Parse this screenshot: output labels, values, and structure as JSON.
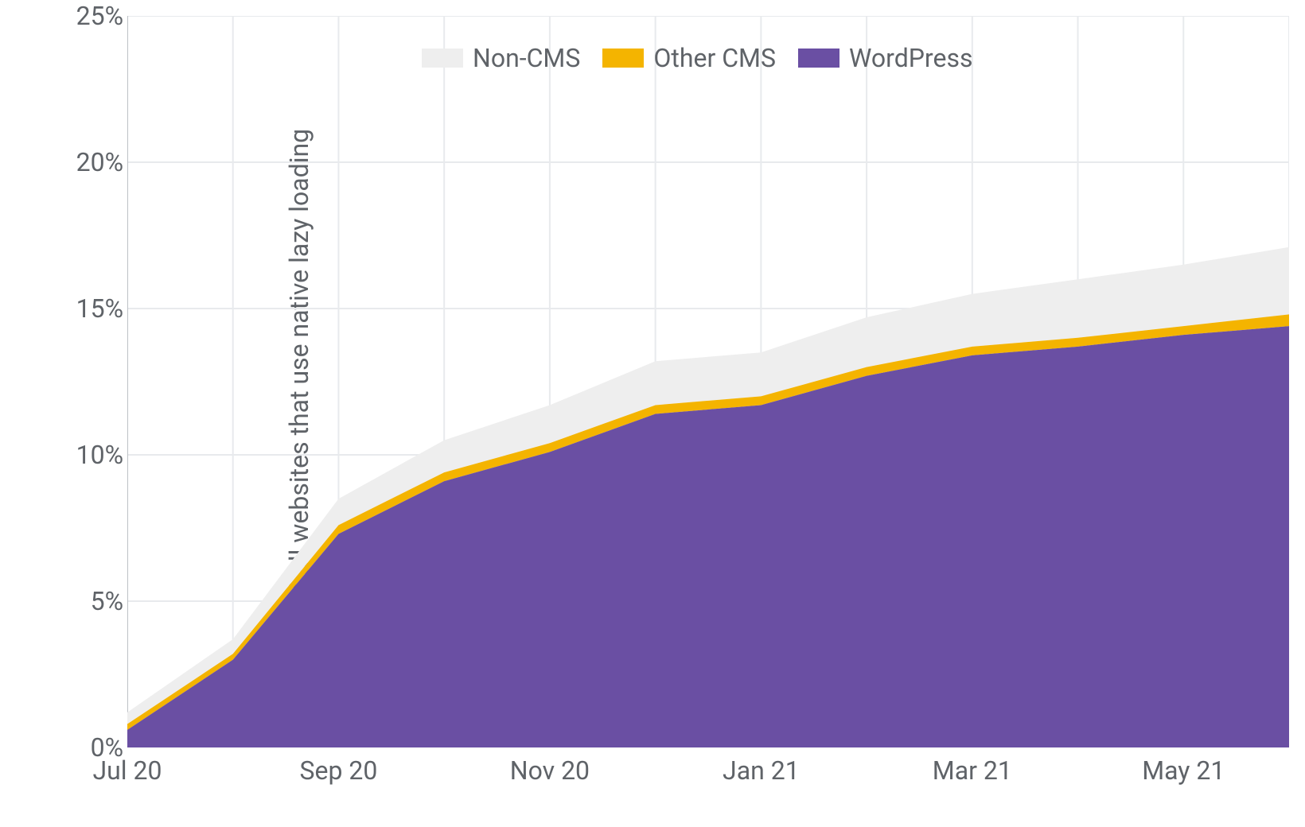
{
  "chart_data": {
    "type": "area",
    "ylabel": "Percent of all websites that use native lazy loading",
    "xlabel": "",
    "ylim": [
      0,
      25
    ],
    "y_ticks": [
      0,
      5,
      10,
      15,
      20,
      25
    ],
    "y_tick_labels": [
      "0%",
      "5%",
      "10%",
      "15%",
      "20%",
      "25%"
    ],
    "categories_full": [
      "Jul 20",
      "Aug 20",
      "Sep 20",
      "Oct 20",
      "Nov 20",
      "Dec 20",
      "Jan 21",
      "Feb 21",
      "Mar 21",
      "Apr 21",
      "May 21",
      "Jun 21"
    ],
    "x_tick_labels": [
      "Jul 20",
      "Sep 20",
      "Nov 20",
      "Jan 21",
      "Mar 21",
      "May 21"
    ],
    "x_tick_indices": [
      0,
      2,
      4,
      6,
      8,
      10
    ],
    "series": [
      {
        "name": "WordPress",
        "color": "#6a4fa3",
        "values": [
          0.6,
          3.0,
          7.3,
          9.1,
          10.1,
          11.4,
          11.7,
          12.7,
          13.4,
          13.7,
          14.1,
          14.4
        ]
      },
      {
        "name": "Other CMS",
        "color": "#f4b400",
        "values": [
          0.2,
          0.2,
          0.3,
          0.3,
          0.3,
          0.3,
          0.3,
          0.3,
          0.3,
          0.3,
          0.3,
          0.4
        ]
      },
      {
        "name": "Non-CMS",
        "color": "#eeeeee",
        "values": [
          0.4,
          0.5,
          0.9,
          1.1,
          1.3,
          1.5,
          1.5,
          1.7,
          1.8,
          2.0,
          2.1,
          2.3
        ]
      }
    ],
    "legend_order": [
      "Non-CMS",
      "Other CMS",
      "WordPress"
    ],
    "legend_position": "top",
    "grid": true
  }
}
